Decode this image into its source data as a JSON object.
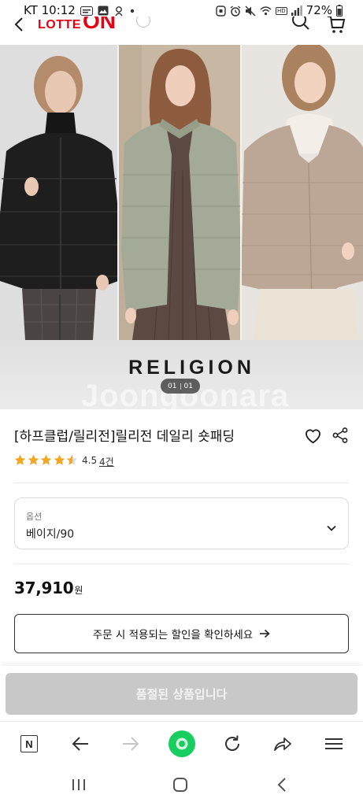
{
  "status_bar": {
    "carrier_time": "KT 10:12",
    "hd_badge": "HD",
    "battery_percent": "72%",
    "left_icons": [
      "app-notification-icon",
      "gallery-icon",
      "app-badge-icon",
      "more-dot-icon"
    ],
    "right_icons": [
      "screen-lock-icon",
      "alarm-icon",
      "mute-icon",
      "wifi-icon",
      "signal-icon",
      "battery-icon"
    ]
  },
  "header": {
    "logo_left": "LOTTE",
    "logo_right": "ON",
    "logo_color": "#e60012",
    "icons": [
      "back-icon",
      "logo-dropdown-icon",
      "search-icon",
      "cart-icon"
    ]
  },
  "product_image": {
    "brand_logo": "RELIGION",
    "pager_current": "01",
    "pager_total": "01",
    "watermark": "Joongoonara",
    "jacket_colors": [
      "#1e1e1e",
      "#a3ab98",
      "#bca796"
    ]
  },
  "product": {
    "title": "[하프클럽/릴리전]릴리전 데일리 숏패딩",
    "rating_text": "4.5",
    "rating_value": 4.5,
    "rating_max": 5,
    "review_count": "4건",
    "star_color": "#f5a623",
    "actions": [
      "heart-icon",
      "share-icon"
    ]
  },
  "option": {
    "label": "옵션",
    "selected_value": "베이지/90"
  },
  "price": {
    "amount": "37,910",
    "unit": "원"
  },
  "discount_button": {
    "label": "주문 시 적용되는 할인을 확인하세요"
  },
  "sold_out_button": {
    "label": "품절된 상품입니다",
    "background": "#c8c8c8"
  },
  "browser_toolbar": {
    "home_letter": "N",
    "items": [
      "naver-home-icon",
      "back-arrow-icon",
      "forward-arrow-icon",
      "green-dot-icon",
      "refresh-icon",
      "share-arrow-icon",
      "menu-icon"
    ],
    "accent": "#19ce60"
  },
  "nav_bar": {
    "items": [
      "recent-apps-icon",
      "home-icon",
      "back-icon"
    ]
  }
}
